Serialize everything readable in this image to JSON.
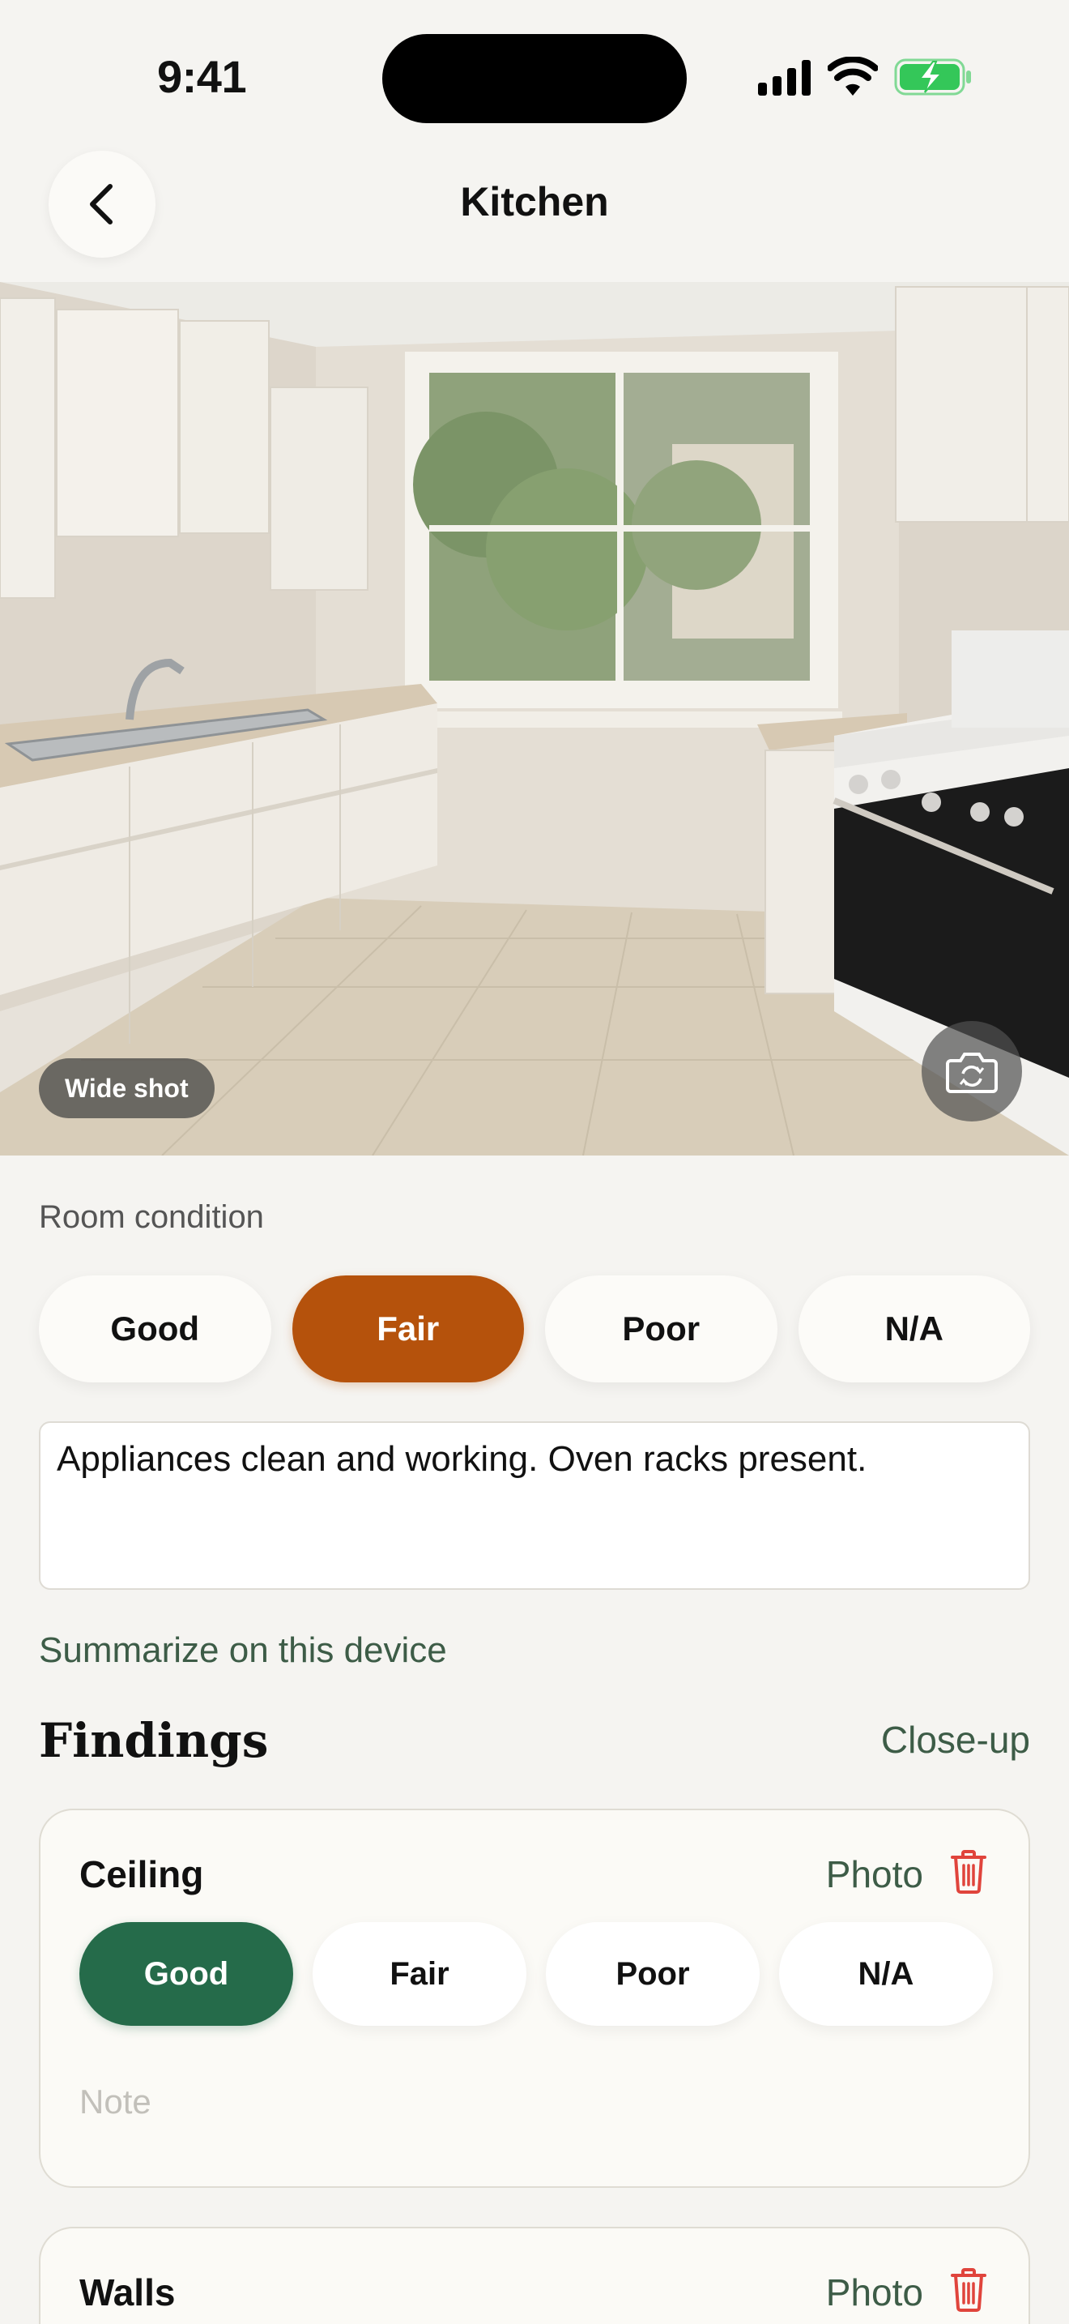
{
  "status_bar": {
    "time": "9:41"
  },
  "nav": {
    "title": "Kitchen",
    "back_icon": "chevron-left-icon"
  },
  "photo": {
    "badge": "Wide shot",
    "retake_icon": "camera-rotate-icon",
    "alt": "Kitchen room photo"
  },
  "room_condition": {
    "label": "Room condition",
    "options": [
      "Good",
      "Fair",
      "Poor",
      "N/A"
    ],
    "selected": "Fair",
    "selected_color": "#b5520c",
    "notes": "Appliances clean and working. Oven racks present."
  },
  "summarize_label": "Summarize on this device",
  "findings": {
    "title": "Findings",
    "closeup_label": "Close-up",
    "items": [
      {
        "name": "Ceiling",
        "photo_label": "Photo",
        "options": [
          "Good",
          "Fair",
          "Poor",
          "N/A"
        ],
        "selected": "Good",
        "selected_color": "#256b4a",
        "note_placeholder": "Note"
      },
      {
        "name": "Walls",
        "photo_label": "Photo"
      }
    ]
  },
  "colors": {
    "accent_green": "#3d5c47",
    "delete_red": "#e0443c",
    "background": "#f5f4f1"
  }
}
